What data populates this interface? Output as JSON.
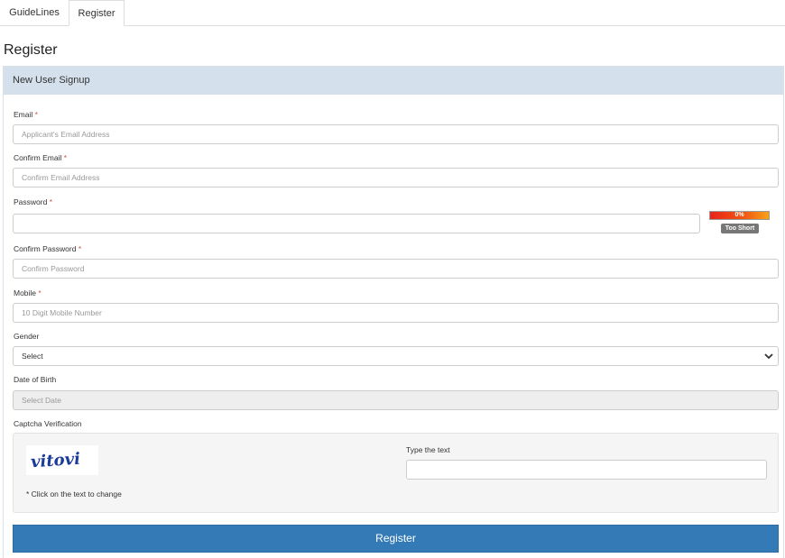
{
  "tabs": [
    {
      "label": "GuideLines",
      "active": false
    },
    {
      "label": "Register",
      "active": true
    }
  ],
  "page_title": "Register",
  "panel": {
    "heading": "New User Signup"
  },
  "form": {
    "required_marker": "*",
    "email": {
      "label": "Email",
      "placeholder": "Applicant's Email Address"
    },
    "confirm_email": {
      "label": "Confirm Email",
      "placeholder": "Confirm Email Address"
    },
    "password": {
      "label": "Password",
      "value": "",
      "strength_percent": "0%",
      "strength_label": "Too Short"
    },
    "confirm_password": {
      "label": "Confirm Password",
      "placeholder": "Confirm Password"
    },
    "mobile": {
      "label": "Mobile",
      "placeholder": "10 Digit Mobile Number"
    },
    "gender": {
      "label": "Gender",
      "selected": "Select"
    },
    "dob": {
      "label": "Date of Birth",
      "placeholder": "Select Date"
    },
    "captcha": {
      "label": "Captcha Verification",
      "image_text": "vitovi",
      "note": "* Click on the text to change",
      "type_label": "Type the text",
      "value": ""
    },
    "submit_label": "Register"
  },
  "colors": {
    "panel_heading_bg": "#d4e0eb",
    "primary_button": "#337ab7",
    "required": "#d9534f",
    "strength_bar": "#e8231c",
    "captcha_text": "#1a3a9c"
  },
  "icons": {
    "gender_dropdown": "chevron-down-icon"
  }
}
